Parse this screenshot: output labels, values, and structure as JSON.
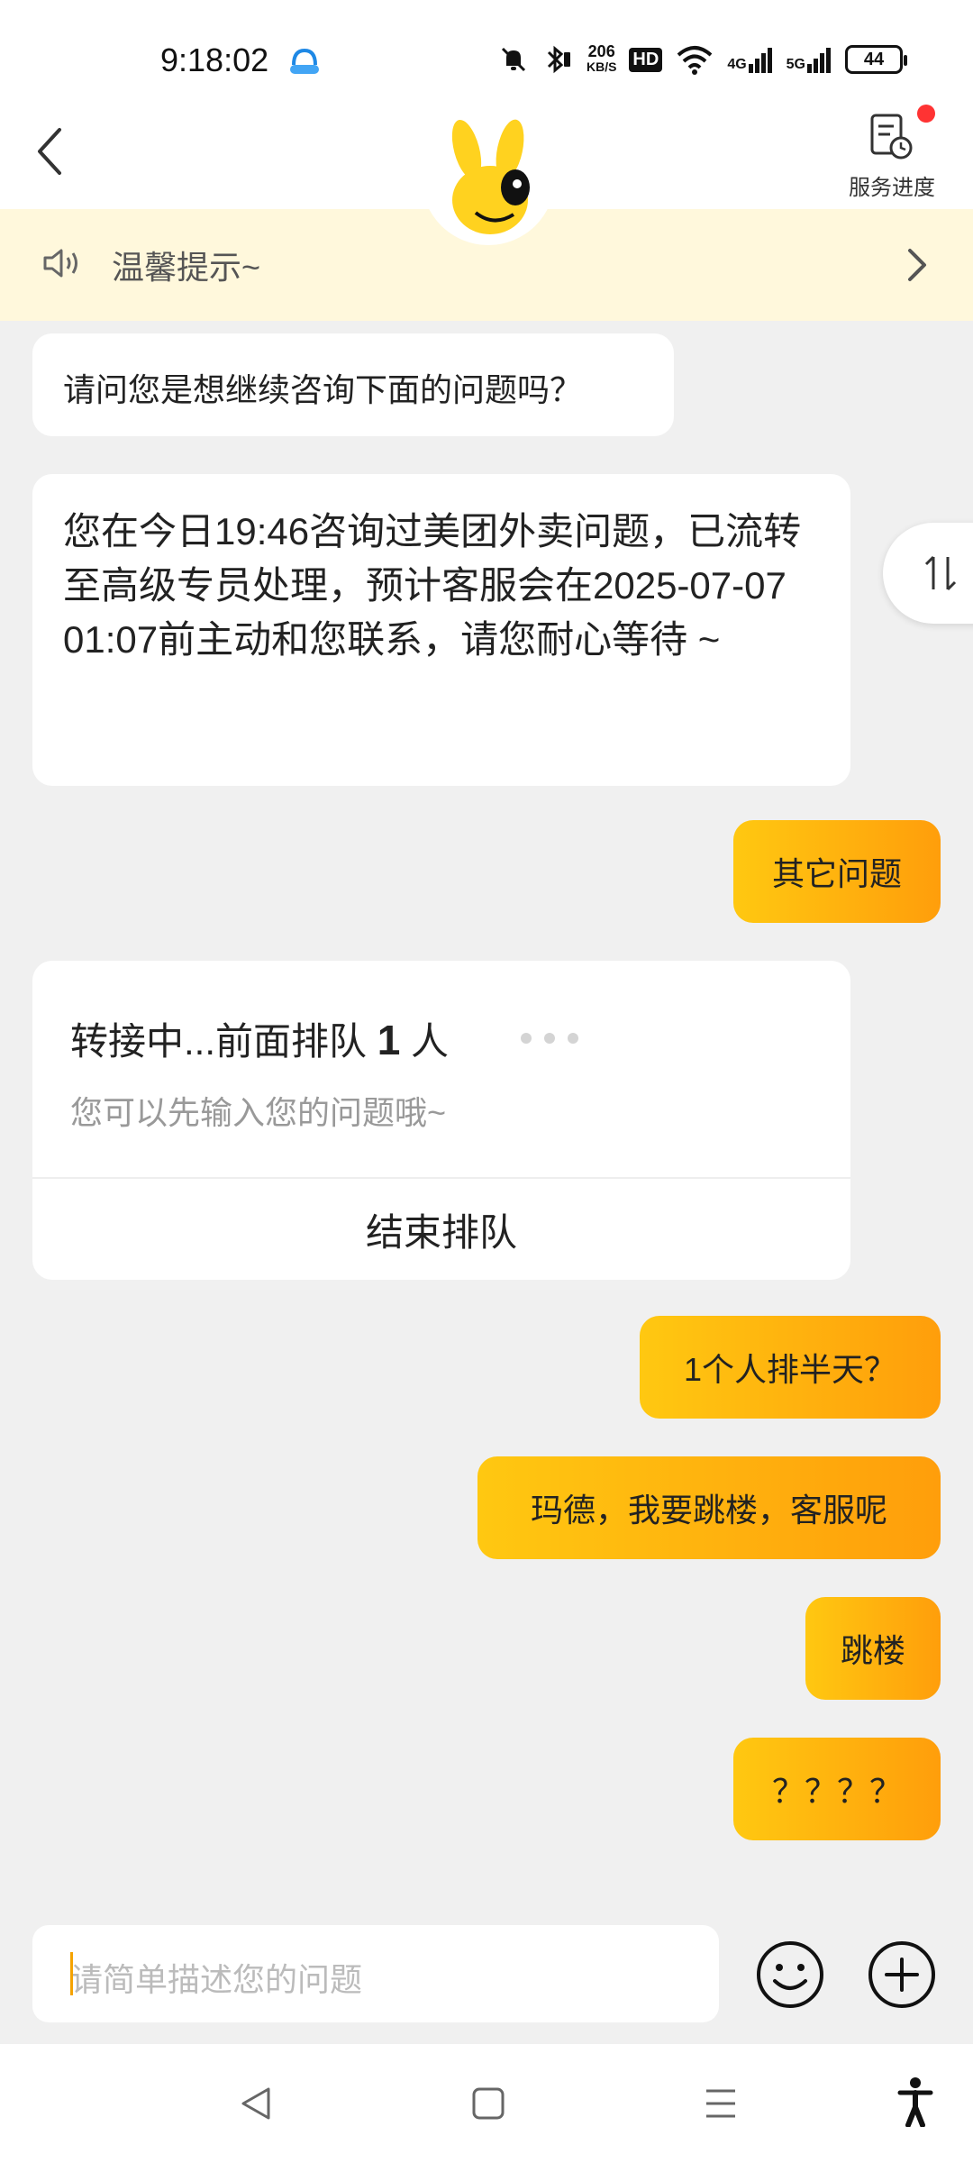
{
  "status_bar": {
    "time": "9:18:02",
    "net_speed_value": "206",
    "net_speed_unit": "KB/S",
    "hd_badge": "HD",
    "sig1_label": "4G",
    "sig2_label": "5G",
    "battery": "44"
  },
  "header": {
    "progress_label": "服务进度"
  },
  "notice": {
    "text": "温馨提示~"
  },
  "messages": {
    "m1": "请问您是想继续咨询下面的问题吗？",
    "m2": "您在今日19:46咨询过美团外卖问题，已流转至高级专员处理，预计客服会在2025-07-07 01:07前主动和您联系，请您耐心等待 ~",
    "m3": "其它问题",
    "m4": "1个人排半天？",
    "m5": "玛德，我要跳楼，客服呢",
    "m6": "跳楼",
    "m7": "？？？？"
  },
  "queue": {
    "title_prefix": "转接中...前面排队",
    "count": "1",
    "title_suffix": "人",
    "subtitle": "您可以先输入您的问题哦~",
    "end_button": "结束排队"
  },
  "input": {
    "placeholder": "请简单描述您的问题"
  },
  "colors": {
    "accent_start": "#ffc811",
    "accent_end": "#ff9e0b",
    "notice_bg": "#fff8dc",
    "badge_red": "#ff3333"
  },
  "icons": [
    "back-arrow-icon",
    "mascot-avatar",
    "service-progress-icon",
    "speaker-icon",
    "chevron-right-icon",
    "swap-vertical-icon",
    "emoji-icon",
    "plus-circle-icon",
    "nav-back-icon",
    "nav-home-icon",
    "nav-menu-icon",
    "accessibility-icon"
  ]
}
